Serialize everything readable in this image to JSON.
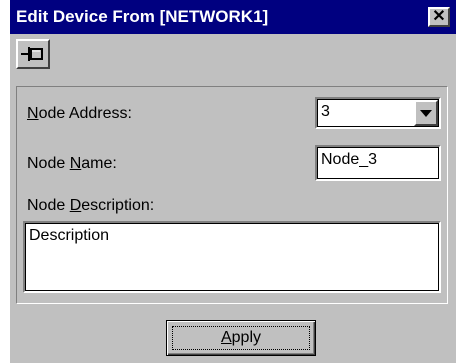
{
  "window": {
    "title": "Edit Device From [NETWORK1]",
    "close_symbol": "✕"
  },
  "toolbar": {
    "pin_icon": "pushpin-icon"
  },
  "form": {
    "node_address": {
      "label_accel": "N",
      "label_rest": "ode Address:",
      "value": "3"
    },
    "node_name": {
      "label_pre": "Node ",
      "label_accel": "N",
      "label_rest": "ame:",
      "value": "Node_3"
    },
    "node_description": {
      "label_pre": "Node ",
      "label_accel": "D",
      "label_rest": "escription:",
      "value": "Description"
    }
  },
  "buttons": {
    "apply": {
      "accel": "A",
      "rest": "pply"
    }
  }
}
